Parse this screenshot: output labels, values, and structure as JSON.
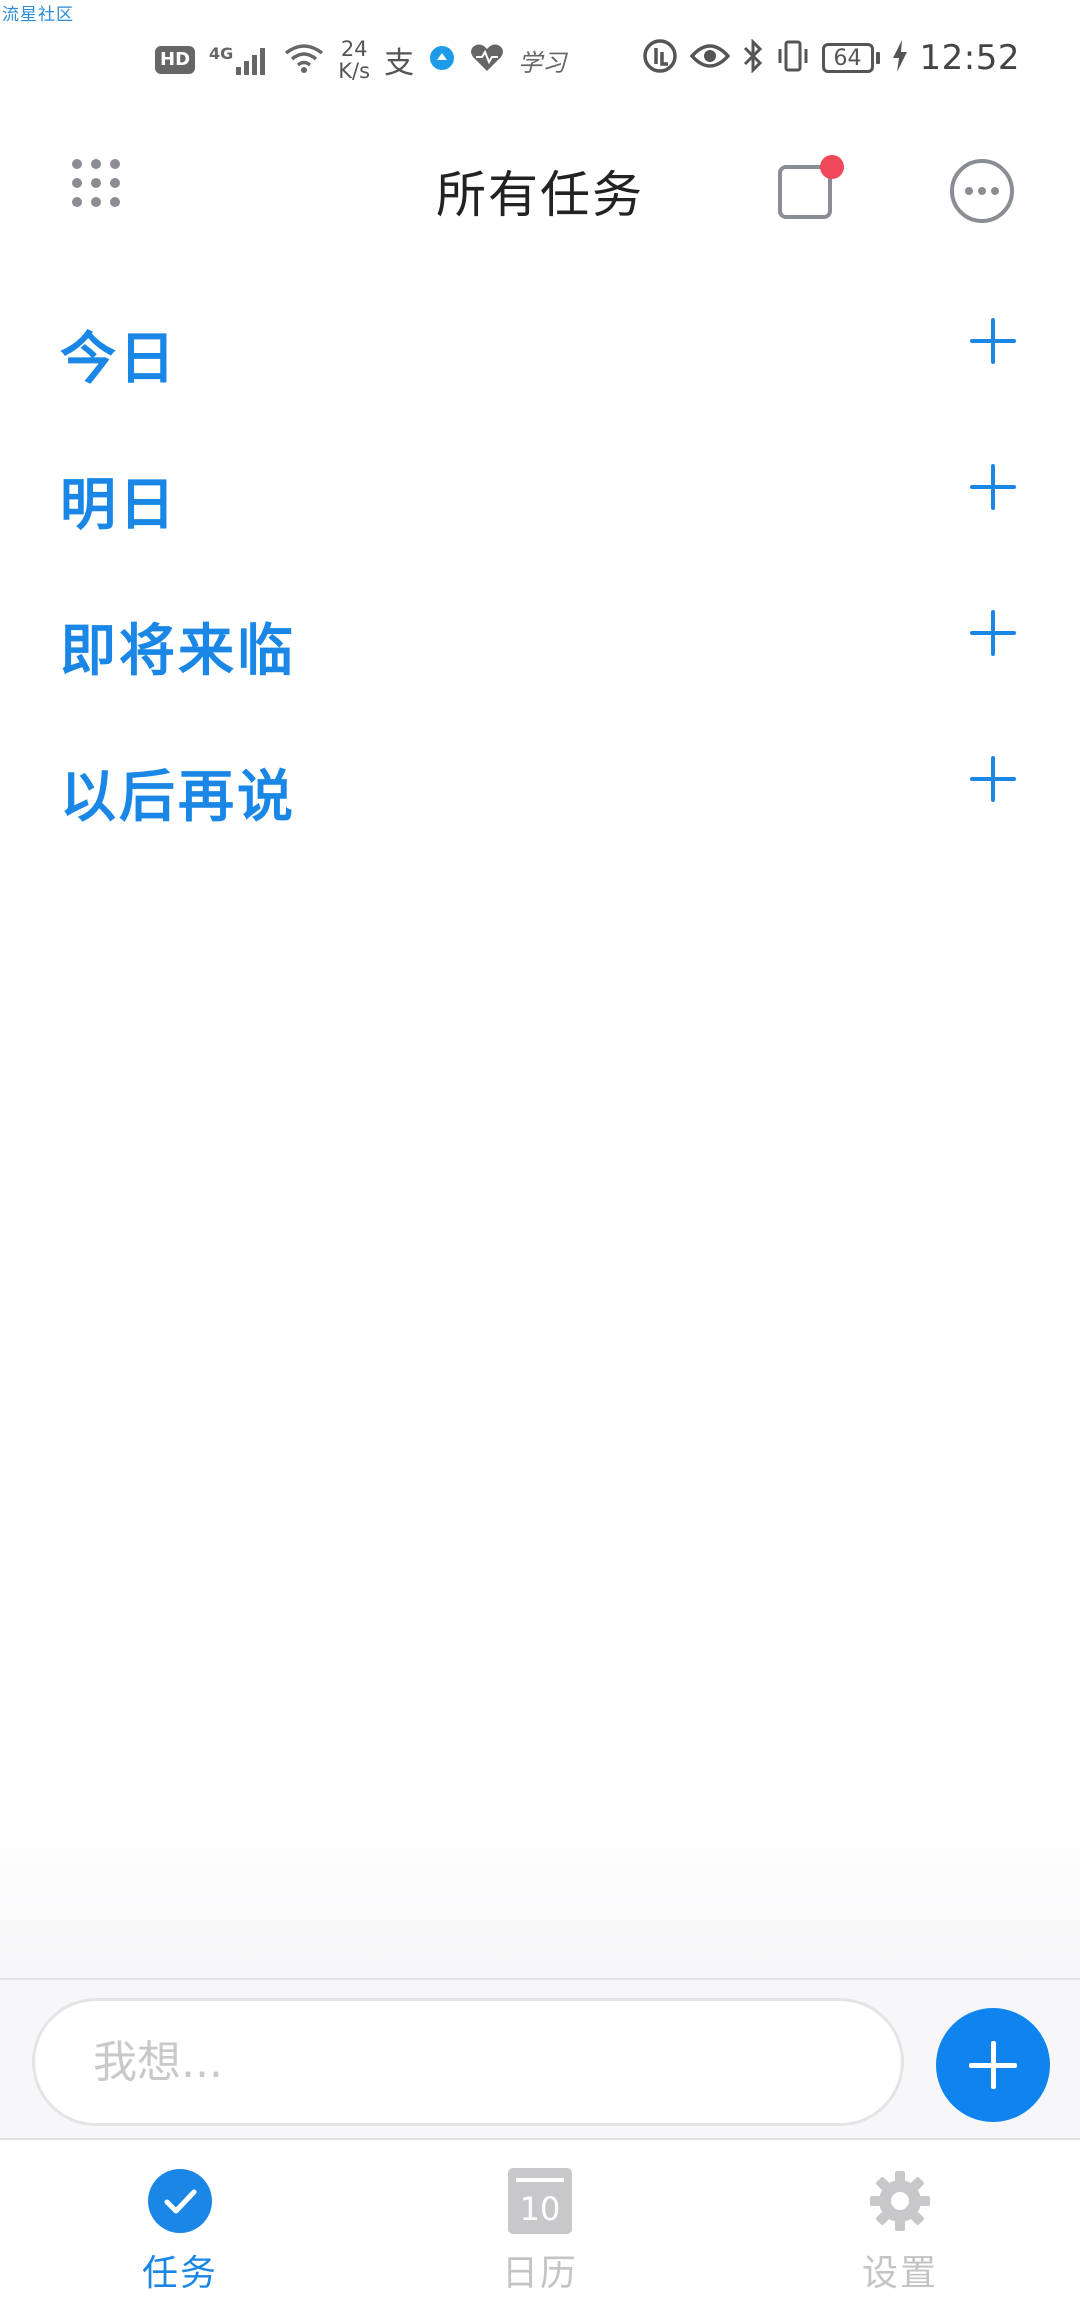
{
  "watermark": "流星社区",
  "status_bar": {
    "hd": "HD",
    "network": "4G",
    "speed_value": "24",
    "speed_unit": "K/s",
    "battery": "64",
    "time": "12:52",
    "icons": [
      "signal-icon",
      "wifi-icon",
      "alipay-icon",
      "app-icon",
      "health-icon",
      "study-icon",
      "data-saver-icon",
      "eye-comfort-icon",
      "bluetooth-icon",
      "vibrate-icon",
      "battery-icon",
      "charging-icon"
    ]
  },
  "header": {
    "title": "所有任务",
    "notification_badge_color": "#f0475a"
  },
  "sections": [
    {
      "label": "今日"
    },
    {
      "label": "明日"
    },
    {
      "label": "即将来临"
    },
    {
      "label": "以后再说"
    }
  ],
  "composer": {
    "placeholder": "我想..."
  },
  "bottom_nav": {
    "items": [
      {
        "label": "任务",
        "icon": "check-circle-icon",
        "active": true
      },
      {
        "label": "日历",
        "icon": "calendar-icon",
        "date": "10",
        "active": false
      },
      {
        "label": "设置",
        "icon": "gear-icon",
        "active": false
      }
    ]
  },
  "colors": {
    "accent": "#1a87e6",
    "fab": "#0f84ee",
    "inactive": "#c4c4c7"
  }
}
